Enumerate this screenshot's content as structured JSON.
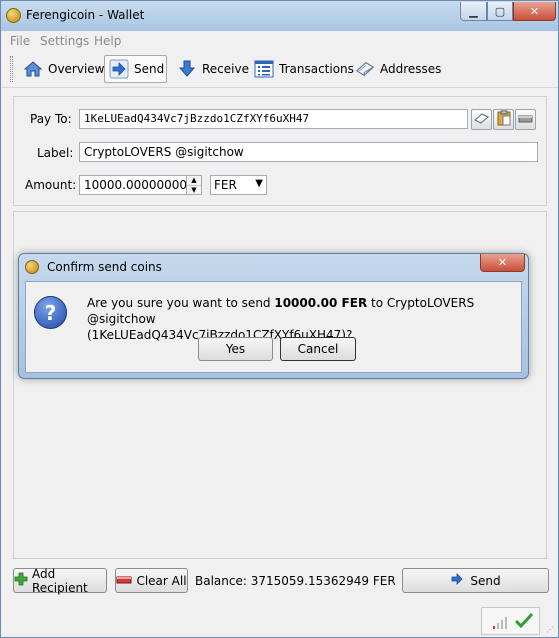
{
  "window": {
    "title": "Ferengicoin - Wallet",
    "min_glyph": "▁",
    "max_glyph": "▢",
    "close_glyph": "✕"
  },
  "menu": [
    "File",
    "Settings",
    "Help"
  ],
  "toolbar": {
    "overview": "Overview",
    "send": "Send",
    "receive": "Receive",
    "transactions": "Transactions",
    "addresses": "Addresses"
  },
  "form": {
    "pay_to_label": "Pay To:",
    "pay_to_value": "1KeLUEadQ434Vc7jBzzdo1CZfXYf6uXH47",
    "label_label": "Label:",
    "label_value": "CryptoLOVERS @sigitchow",
    "amount_label": "Amount:",
    "amount_value": "10000.00000000",
    "unit": "FER"
  },
  "bottom": {
    "add_recipient": "Add Recipient",
    "clear_all": "Clear All",
    "balance": "Balance: 3715059.15362949 FER",
    "send": "Send"
  },
  "dialog": {
    "title": "Confirm send coins",
    "message_prefix": "Are you sure you want to send ",
    "amount": "10000.00 FER",
    "message_mid": " to CryptoLOVERS @sigitchow",
    "message_line2": "(1KeLUEadQ434Vc7jBzzdo1CZfXYf6uXH47)?",
    "yes": "Yes",
    "cancel": "Cancel",
    "close_glyph": "✕",
    "icon_glyph": "?"
  },
  "colors": {
    "accent": "#1f5bc4",
    "check": "#2e9e2e"
  }
}
